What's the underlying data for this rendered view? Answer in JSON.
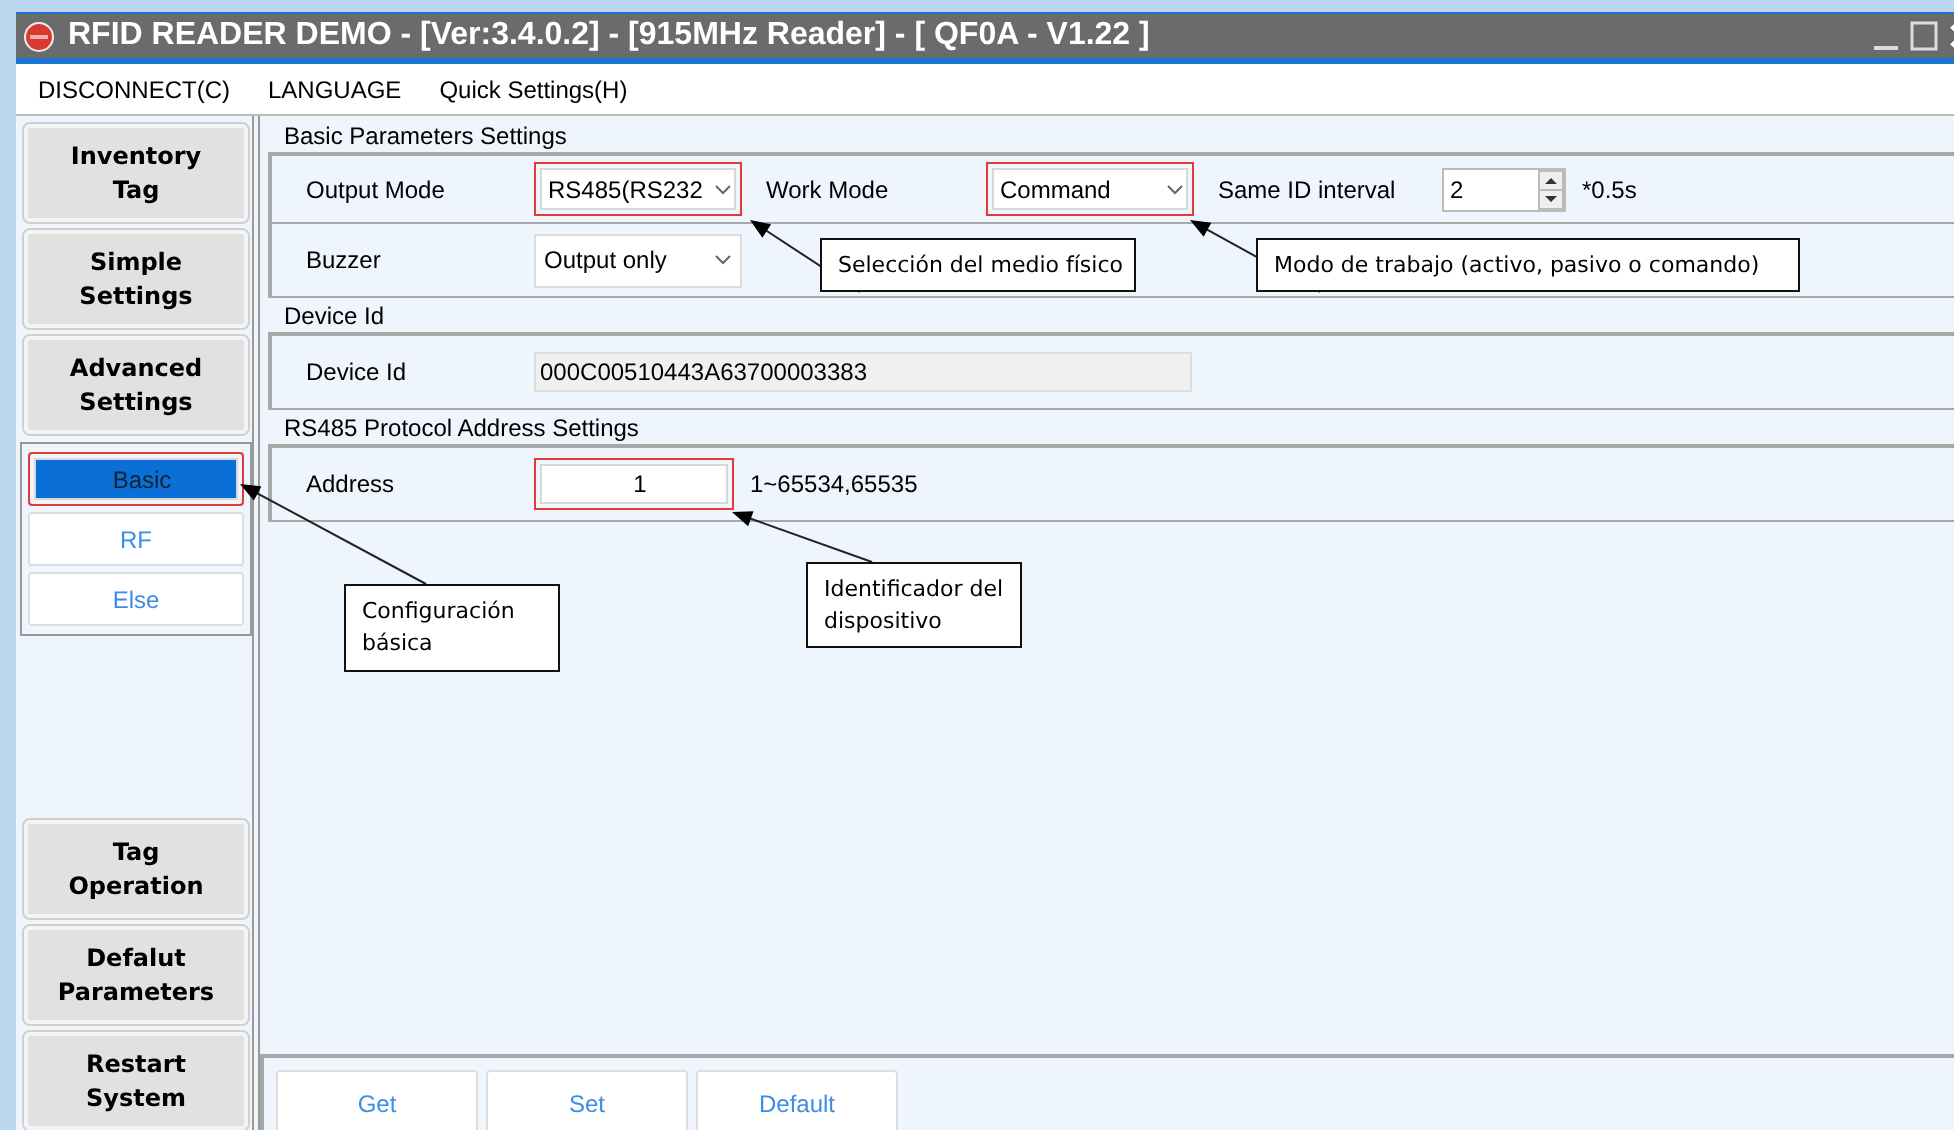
{
  "window": {
    "title": "RFID READER DEMO - [Ver:3.4.0.2] - [915MHz Reader] - [ QF0A - V1.22 ]"
  },
  "menu": [
    "DISCONNECT(C)",
    "LANGUAGE",
    "Quick Settings(H)"
  ],
  "sidebar": {
    "top_items": [
      {
        "label": "Inventory Tag"
      },
      {
        "label": "Simple Settings"
      },
      {
        "label": "Advanced Settings",
        "children": [
          {
            "label": "Basic",
            "selected": true,
            "highlighted": true
          },
          {
            "label": "RF",
            "selected": false,
            "highlighted": false
          },
          {
            "label": "Else",
            "selected": false,
            "highlighted": false
          }
        ]
      }
    ],
    "bottom_items": [
      {
        "label": "Tag Operation"
      },
      {
        "label": "Defalut Parameters"
      },
      {
        "label": "Restart System"
      }
    ]
  },
  "groups": [
    {
      "title": "Basic Parameters Settings",
      "rows": [
        [
          {
            "kind": "label",
            "text": "Output Mode"
          },
          {
            "kind": "dropdown",
            "value": "RS485(RS232",
            "highlighted": true
          },
          {
            "kind": "label",
            "text": "Work Mode"
          },
          {
            "kind": "dropdown",
            "value": "Command",
            "highlighted": true
          },
          {
            "kind": "label",
            "text": "Same ID interval"
          },
          {
            "kind": "spinner",
            "value": "2"
          },
          {
            "kind": "unit",
            "text": "*0.5s"
          }
        ],
        [
          {
            "kind": "label",
            "text": "Buzzer"
          },
          {
            "kind": "dropdown",
            "value": "Output only",
            "highlighted": false
          }
        ]
      ]
    },
    {
      "title": "Device Id",
      "rows": [
        [
          {
            "kind": "label",
            "text": "Device Id"
          },
          {
            "kind": "readonly",
            "value": "000C00510443A63700003383"
          }
        ]
      ]
    },
    {
      "title": "RS485 Protocol Address Settings",
      "rows": [
        [
          {
            "kind": "label",
            "text": "Address"
          },
          {
            "kind": "input",
            "value": "1",
            "highlighted": true
          },
          {
            "kind": "unit",
            "text": "1~65534,65535"
          }
        ]
      ]
    }
  ],
  "buttons": [
    "Get",
    "Set",
    "Default"
  ],
  "callouts": [
    "Selección del medio físico",
    "Modo de trabajo (activo, pasivo o comando)",
    "Configuración básica",
    "Identificador del dispositivo"
  ]
}
